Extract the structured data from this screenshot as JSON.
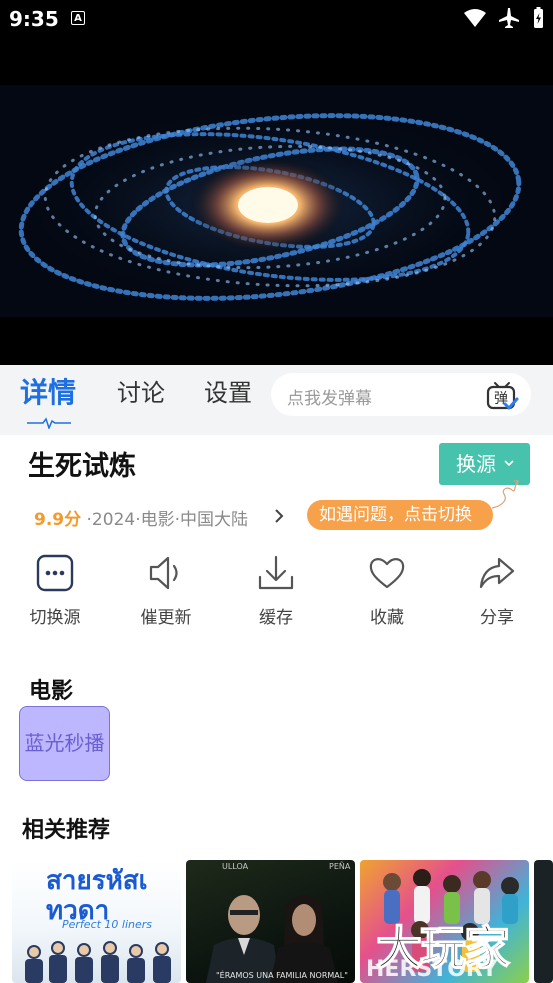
{
  "status_bar": {
    "time": "9:35",
    "notification_icon": "A"
  },
  "tabs": [
    {
      "label": "详情",
      "active": true
    },
    {
      "label": "讨论",
      "active": false
    },
    {
      "label": "设置",
      "active": false
    }
  ],
  "danmu": {
    "placeholder": "点我发弹幕",
    "icon_text": "弹"
  },
  "movie": {
    "title": "生死试炼",
    "rating": "9.9分",
    "meta": "·2024·电影·中国大陆",
    "switch_source_label": "换源",
    "tip": "如遇问题，点击切换"
  },
  "actions": [
    {
      "label": "切换源",
      "icon": "more-icon"
    },
    {
      "label": "催更新",
      "icon": "speaker-icon"
    },
    {
      "label": "缓存",
      "icon": "download-icon"
    },
    {
      "label": "收藏",
      "icon": "heart-icon"
    },
    {
      "label": "分享",
      "icon": "share-icon"
    }
  ],
  "sources": {
    "heading": "电影",
    "items": [
      {
        "label": "蓝光秒播"
      }
    ]
  },
  "recommendations": {
    "heading": "相关推荐",
    "posters": [
      {
        "title_text": "สายรหัสเทวดา",
        "subtitle": "Perfect 10 liners"
      },
      {
        "top_left": "ULLOA",
        "top_right": "PEÑA",
        "caption": "\"ÉRAMOS UNA FAMILIA NORMAL\""
      },
      {
        "overlay": "大玩家"
      },
      {}
    ]
  },
  "colors": {
    "accent_blue": "#1e6fe0",
    "teal": "#46c2ad",
    "orange": "#f7a24b",
    "chip": "#bdb7ff"
  }
}
